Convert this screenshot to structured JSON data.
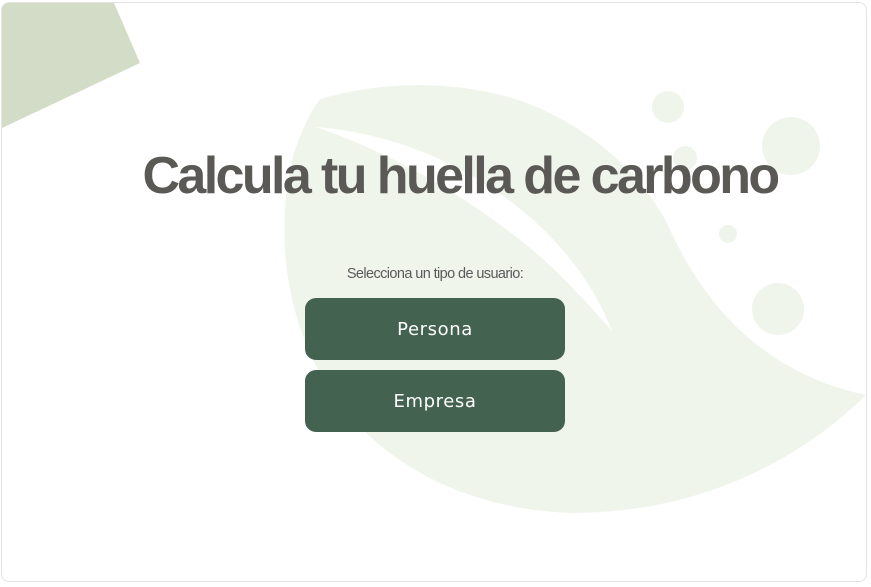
{
  "page": {
    "title": "Calcula tu huella de carbono",
    "subtitle": "Selecciona un tipo de usuario:"
  },
  "user_types": [
    {
      "label": "Persona"
    },
    {
      "label": "Empresa"
    }
  ],
  "colors": {
    "primary_button": "#43624f",
    "title_text": "#5b5955",
    "corner_shape": "#d3dcc6",
    "leaf_background": "#f0f5eb"
  },
  "decorations": {
    "corner": "corner-triangle",
    "background": "leaf-icon",
    "bubbles": "bubble-icon"
  }
}
